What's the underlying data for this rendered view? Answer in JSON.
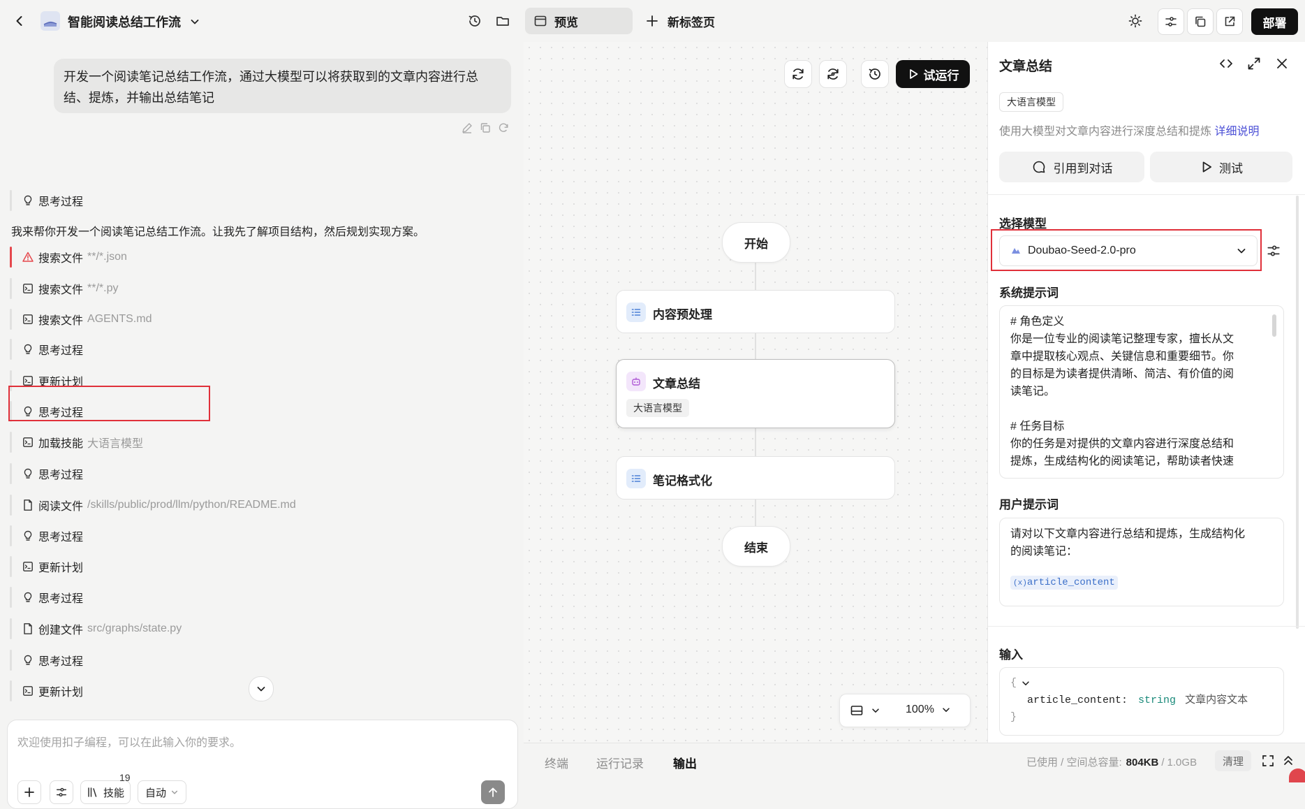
{
  "header": {
    "project_title": "智能阅读总结工作流",
    "preview_tab": "预览",
    "new_tab": "新标签页",
    "deploy_label": "部署"
  },
  "chat": {
    "user_message": "开发一个阅读笔记总结工作流，通过大模型可以将获取到的文章内容进行总结、提炼，并输出总结笔记",
    "assistant_intro": "我来帮你开发一个阅读笔记总结工作流。让我先了解项目结构，然后规划实现方案。",
    "steps": [
      {
        "icon": "lightbulb-icon",
        "label": "思考过程",
        "arg": "",
        "error": false
      },
      {
        "icon": "warning-icon",
        "label": "搜索文件",
        "arg": "**/*.json",
        "error": true
      },
      {
        "icon": "terminal-icon",
        "label": "搜索文件",
        "arg": "**/*.py",
        "error": false
      },
      {
        "icon": "terminal-icon",
        "label": "搜索文件",
        "arg": "AGENTS.md",
        "error": false
      },
      {
        "icon": "lightbulb-icon",
        "label": "思考过程",
        "arg": "",
        "error": false
      },
      {
        "icon": "terminal-icon",
        "label": "更新计划",
        "arg": "",
        "error": false
      },
      {
        "icon": "lightbulb-icon",
        "label": "思考过程",
        "arg": "",
        "error": false
      },
      {
        "icon": "terminal-icon",
        "label": "加载技能",
        "arg": "大语言模型",
        "error": false
      },
      {
        "icon": "lightbulb-icon",
        "label": "思考过程",
        "arg": "",
        "error": false
      },
      {
        "icon": "file-icon",
        "label": "阅读文件",
        "arg": "/skills/public/prod/llm/python/README.md",
        "error": false
      },
      {
        "icon": "lightbulb-icon",
        "label": "思考过程",
        "arg": "",
        "error": false
      },
      {
        "icon": "terminal-icon",
        "label": "更新计划",
        "arg": "",
        "error": false
      },
      {
        "icon": "lightbulb-icon",
        "label": "思考过程",
        "arg": "",
        "error": false
      },
      {
        "icon": "file-icon",
        "label": "创建文件",
        "arg": "src/graphs/state.py",
        "error": false
      },
      {
        "icon": "lightbulb-icon",
        "label": "思考过程",
        "arg": "",
        "error": false
      },
      {
        "icon": "terminal-icon",
        "label": "更新计划",
        "arg": "",
        "error": false
      }
    ],
    "composer_placeholder": "欢迎使用扣子编程，可以在此输入你的要求。",
    "skills_label": "技能",
    "skills_count": "19",
    "mode_label": "自动"
  },
  "canvas": {
    "run_label": "试运行",
    "start_node": "开始",
    "end_node": "结束",
    "nodes": [
      {
        "title": "内容预处理",
        "subtitle": ""
      },
      {
        "title": "文章总结",
        "subtitle": "大语言模型"
      },
      {
        "title": "笔记格式化",
        "subtitle": ""
      }
    ],
    "zoom": "100%"
  },
  "bottom": {
    "tabs": [
      "终端",
      "运行记录",
      "输出"
    ],
    "active_tab": "输出",
    "storage_label": "已使用 / 空间总容量:",
    "storage_used": "804KB",
    "storage_sep": "/",
    "storage_total": "1.0GB",
    "clear_label": "清理"
  },
  "panel": {
    "title": "文章总结",
    "type_tag": "大语言模型",
    "description": "使用大模型对文章内容进行深度总结和提炼",
    "detail_link": "详细说明",
    "ref_button": "引用到对话",
    "test_button": "测试",
    "model_section": "选择模型",
    "model_value": "Doubao-Seed-2.0-pro",
    "system_prompt_section": "系统提示词",
    "system_prompt_lines": [
      "# 角色定义",
      "你是一位专业的阅读笔记整理专家，擅长从文",
      "章中提取核心观点、关键信息和重要细节。你",
      "的目标是为读者提供清晰、简洁、有价值的阅",
      "读笔记。",
      "",
      "# 任务目标",
      "你的任务是对提供的文章内容进行深度总结和",
      "提炼，生成结构化的阅读笔记，帮助读者快速"
    ],
    "user_prompt_section": "用户提示词",
    "user_prompt_lines": [
      "请对以下文章内容进行总结和提炼，生成结构化",
      "的阅读笔记："
    ],
    "user_prompt_variable": "article_content",
    "input_section": "输入",
    "input_open_brace": "{",
    "input_close_brace": "}",
    "input_field_name": "article_content:",
    "input_field_type": "string",
    "input_field_desc": "文章内容文本"
  },
  "colors": {
    "accent_link": "#4b4fd6",
    "error": "#e5484d",
    "highlight_box": "#e0303a",
    "deploy_bg": "#111111"
  }
}
